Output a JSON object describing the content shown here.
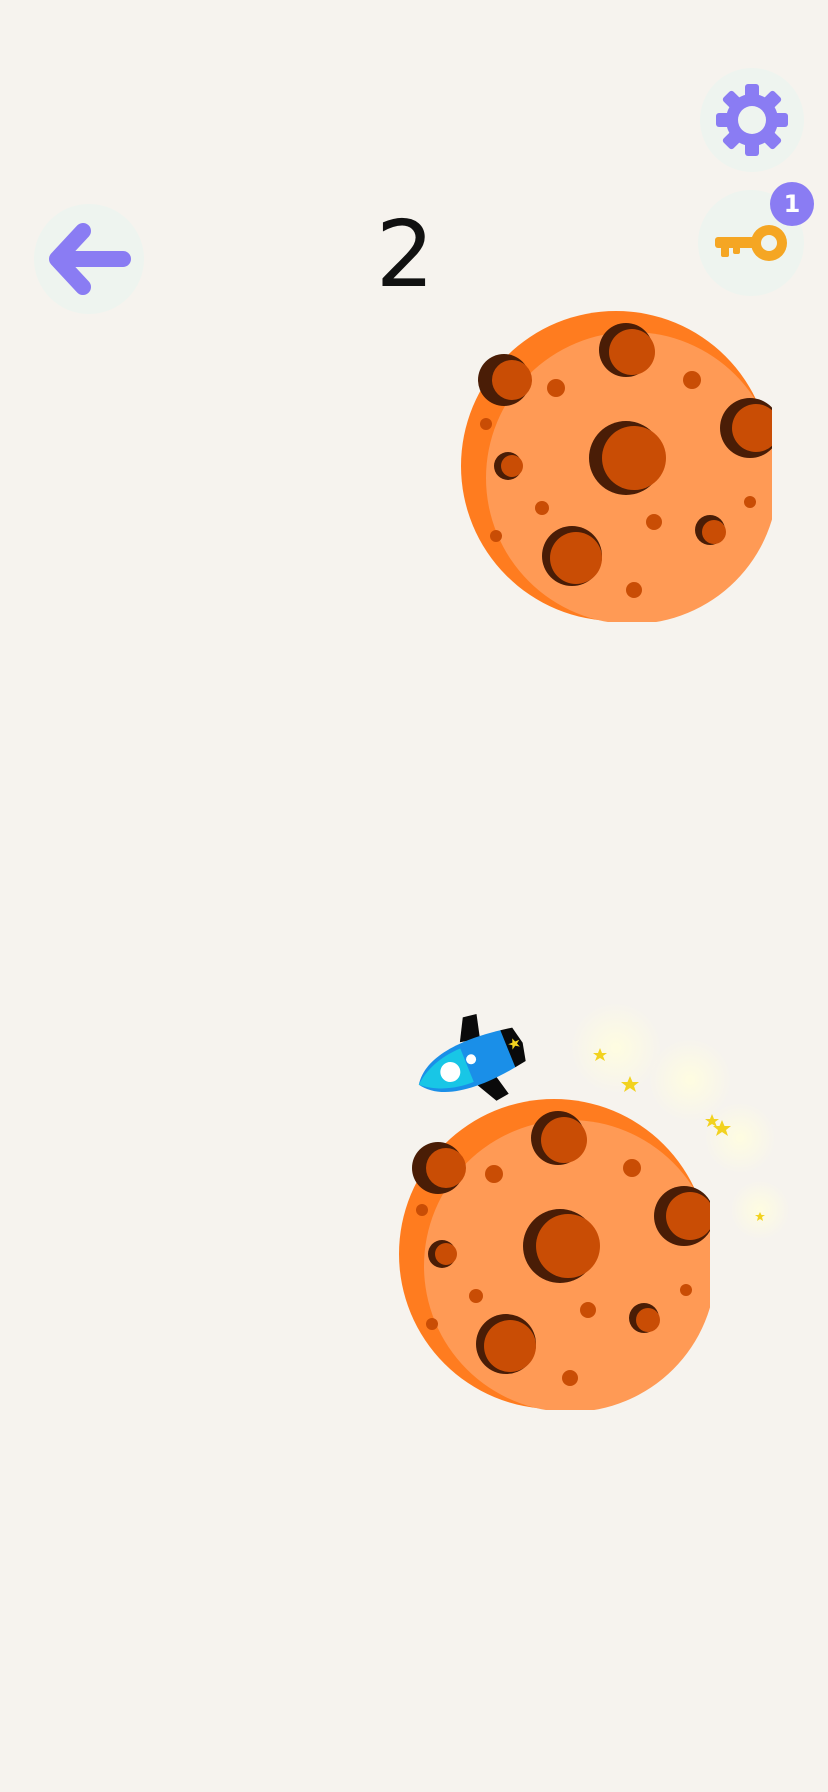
{
  "hud": {
    "score": "2",
    "keys_count": "1",
    "back_icon": "arrow-left-icon",
    "settings_icon": "gear-icon",
    "key_icon": "key-icon"
  },
  "scene": {
    "background_color": "#f6f3ee",
    "planet_color": "#ff9a55",
    "planet_rim_color": "#ff7c1f",
    "crater_color": "#c94d05",
    "rocket_color": "#1a8fe8",
    "accent_color": "#8a7cf3",
    "key_color": "#f5a623"
  }
}
